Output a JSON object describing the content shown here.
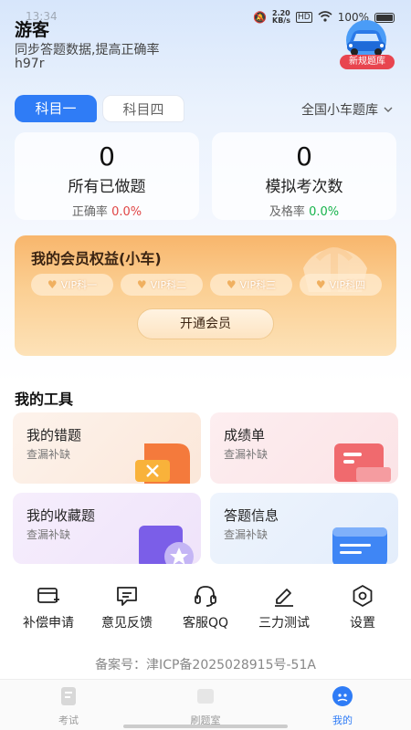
{
  "status_bar": {
    "time": "13:34",
    "network_speed": "2.20",
    "speed_unit": "KB/s",
    "battery": "100%"
  },
  "user": {
    "name": "游客",
    "tagline": "同步答题数据,提高正确率",
    "id": "h97r"
  },
  "badge": {
    "label": "新规题库"
  },
  "subjects": {
    "tabs": [
      "科目一",
      "科目四"
    ],
    "bank": "全国小车题库"
  },
  "stats": [
    {
      "value": "0",
      "title": "所有已做题",
      "rate_label": "正确率",
      "rate_value": "0.0%"
    },
    {
      "value": "0",
      "title": "模拟考次数",
      "rate_label": "及格率",
      "rate_value": "0.0%"
    }
  ],
  "vip": {
    "title": "我的会员权益(小车)",
    "badges": [
      "VIP科一",
      "VIP科二",
      "VIP科三",
      "VIP科四"
    ],
    "button": "开通会员"
  },
  "tools": {
    "title": "我的工具",
    "items": [
      {
        "title": "我的错题",
        "subtitle": "查漏补缺"
      },
      {
        "title": "成绩单",
        "subtitle": "查漏补缺"
      },
      {
        "title": "我的收藏题",
        "subtitle": "查漏补缺"
      },
      {
        "title": "答题信息",
        "subtitle": "查漏补缺"
      }
    ]
  },
  "quick_actions": [
    "补偿申请",
    "意见反馈",
    "客服QQ",
    "三力测试",
    "设置"
  ],
  "icp": "备案号：津ICP备2025028915号-51A",
  "nav": [
    "考试",
    "刷题室",
    "我的"
  ],
  "colors": {
    "accent": "#2f7cf6",
    "vip_orange": "#f8b66c",
    "success": "#16b34b",
    "error": "#e04545"
  }
}
